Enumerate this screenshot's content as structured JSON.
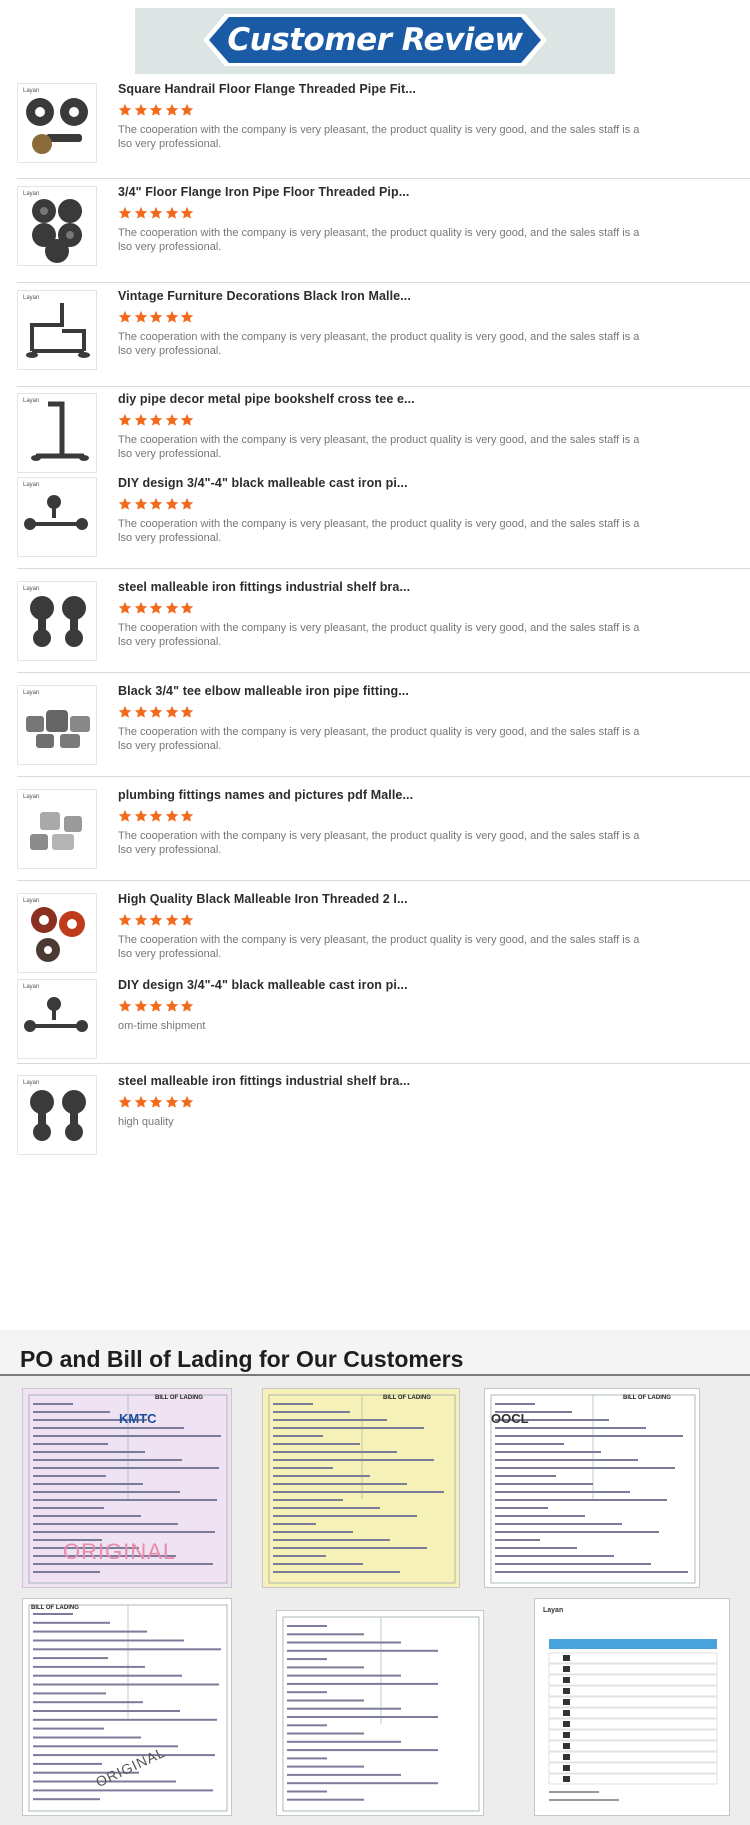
{
  "banner": {
    "title": "Customer Review"
  },
  "reviews": [
    {
      "title": "Square Handrail Floor Flange Threaded Pipe Fit...",
      "rating": 5,
      "comment": "The cooperation with the company is very pleasant, the product quality is very good, and the sales staff is a lso very professional.",
      "thumb_icon": "floor-flange-icon",
      "brand": "Layan"
    },
    {
      "title": "3/4\" Floor Flange Iron Pipe Floor Threaded Pip...",
      "rating": 5,
      "comment": "The cooperation with the company is very pleasant, the product quality is very good, and the sales staff is a lso very professional.",
      "thumb_icon": "flange-stack-icon",
      "brand": "Layan"
    },
    {
      "title": "Vintage Furniture Decorations Black Iron Malle...",
      "rating": 5,
      "comment": "The cooperation with the company is very pleasant, the product quality is very good, and the sales staff is a lso very professional.",
      "thumb_icon": "pipe-frame-icon",
      "brand": "Layan"
    },
    {
      "title": "diy pipe decor metal pipe bookshelf cross tee e...",
      "rating": 5,
      "comment": "The cooperation with the company is very pleasant, the product quality is very good, and the sales staff is a lso very professional.",
      "thumb_icon": "pipe-stand-icon",
      "brand": "Layan"
    },
    {
      "title": "DIY design 3/4\"-4\" black malleable cast iron pi...",
      "rating": 5,
      "comment": "The cooperation with the company is very pleasant, the product quality is very good, and the sales staff is a lso very professional.",
      "thumb_icon": "towel-bar-icon",
      "brand": "Layan"
    },
    {
      "title": "steel malleable iron fittings industrial shelf bra...",
      "rating": 5,
      "comment": "The cooperation with the company is very pleasant, the product quality is very good, and the sales staff is a lso very professional.",
      "thumb_icon": "shelf-bracket-icon",
      "brand": "Layan"
    },
    {
      "title": "Black 3/4\" tee elbow malleable iron pipe fitting...",
      "rating": 5,
      "comment": "The cooperation with the company is very pleasant, the product quality is very good, and the sales staff is a lso very professional.",
      "thumb_icon": "tee-elbow-icon",
      "brand": "Layan"
    },
    {
      "title": "plumbing fittings names and pictures pdf Malle...",
      "rating": 5,
      "comment": "The cooperation with the company is very pleasant, the product quality is very good, and the sales staff is a lso very professional.",
      "thumb_icon": "galvanized-fittings-icon",
      "brand": "Layan"
    },
    {
      "title": "High Quality Black Malleable Iron Threaded 2 I...",
      "rating": 5,
      "comment": "The cooperation with the company is very pleasant, the product quality is very good, and the sales staff is a lso very professional.",
      "thumb_icon": "red-flange-icon",
      "brand": "Layan"
    },
    {
      "title": "DIY design 3/4\"-4\" black malleable cast iron pi...",
      "rating": 5,
      "comment": "om-time shipment",
      "thumb_icon": "towel-bar-icon",
      "brand": "Layan"
    },
    {
      "title": "steel malleable iron fittings industrial shelf bra...",
      "rating": 5,
      "comment": "high quality",
      "thumb_icon": "shelf-bracket-icon",
      "brand": "Layan"
    }
  ],
  "documents_section": {
    "title": "PO and Bill of Lading for Our Customers",
    "documents": [
      {
        "kind": "bill-of-lading",
        "heading": "BILL OF LADING",
        "logo_text": "KMTC",
        "stamp": "ORIGINAL",
        "tint": "#efe2f2"
      },
      {
        "kind": "bill-of-lading",
        "heading": "BILL OF LADING",
        "logo_text": "",
        "stamp": "",
        "tint": "#f6f1b7"
      },
      {
        "kind": "bill-of-lading",
        "heading": "BILL OF LADING",
        "logo_text": "OOCL",
        "stamp": "",
        "tint": "#ffffff"
      },
      {
        "kind": "bill-of-lading",
        "heading": "BILL OF LADING",
        "logo_text": "",
        "stamp": "ORIGINAL",
        "tint": "#ffffff"
      },
      {
        "kind": "bill-of-lading",
        "heading": "",
        "logo_text": "",
        "stamp": "",
        "tint": "#ffffff"
      },
      {
        "kind": "purchase-order",
        "heading": "",
        "logo_text": "Layan",
        "stamp": "",
        "tint": "#ffffff"
      }
    ]
  },
  "colors": {
    "banner_blue": "#1b5ba6",
    "star_orange": "#f26b1d",
    "stamp_pink": "#e88aa8"
  }
}
